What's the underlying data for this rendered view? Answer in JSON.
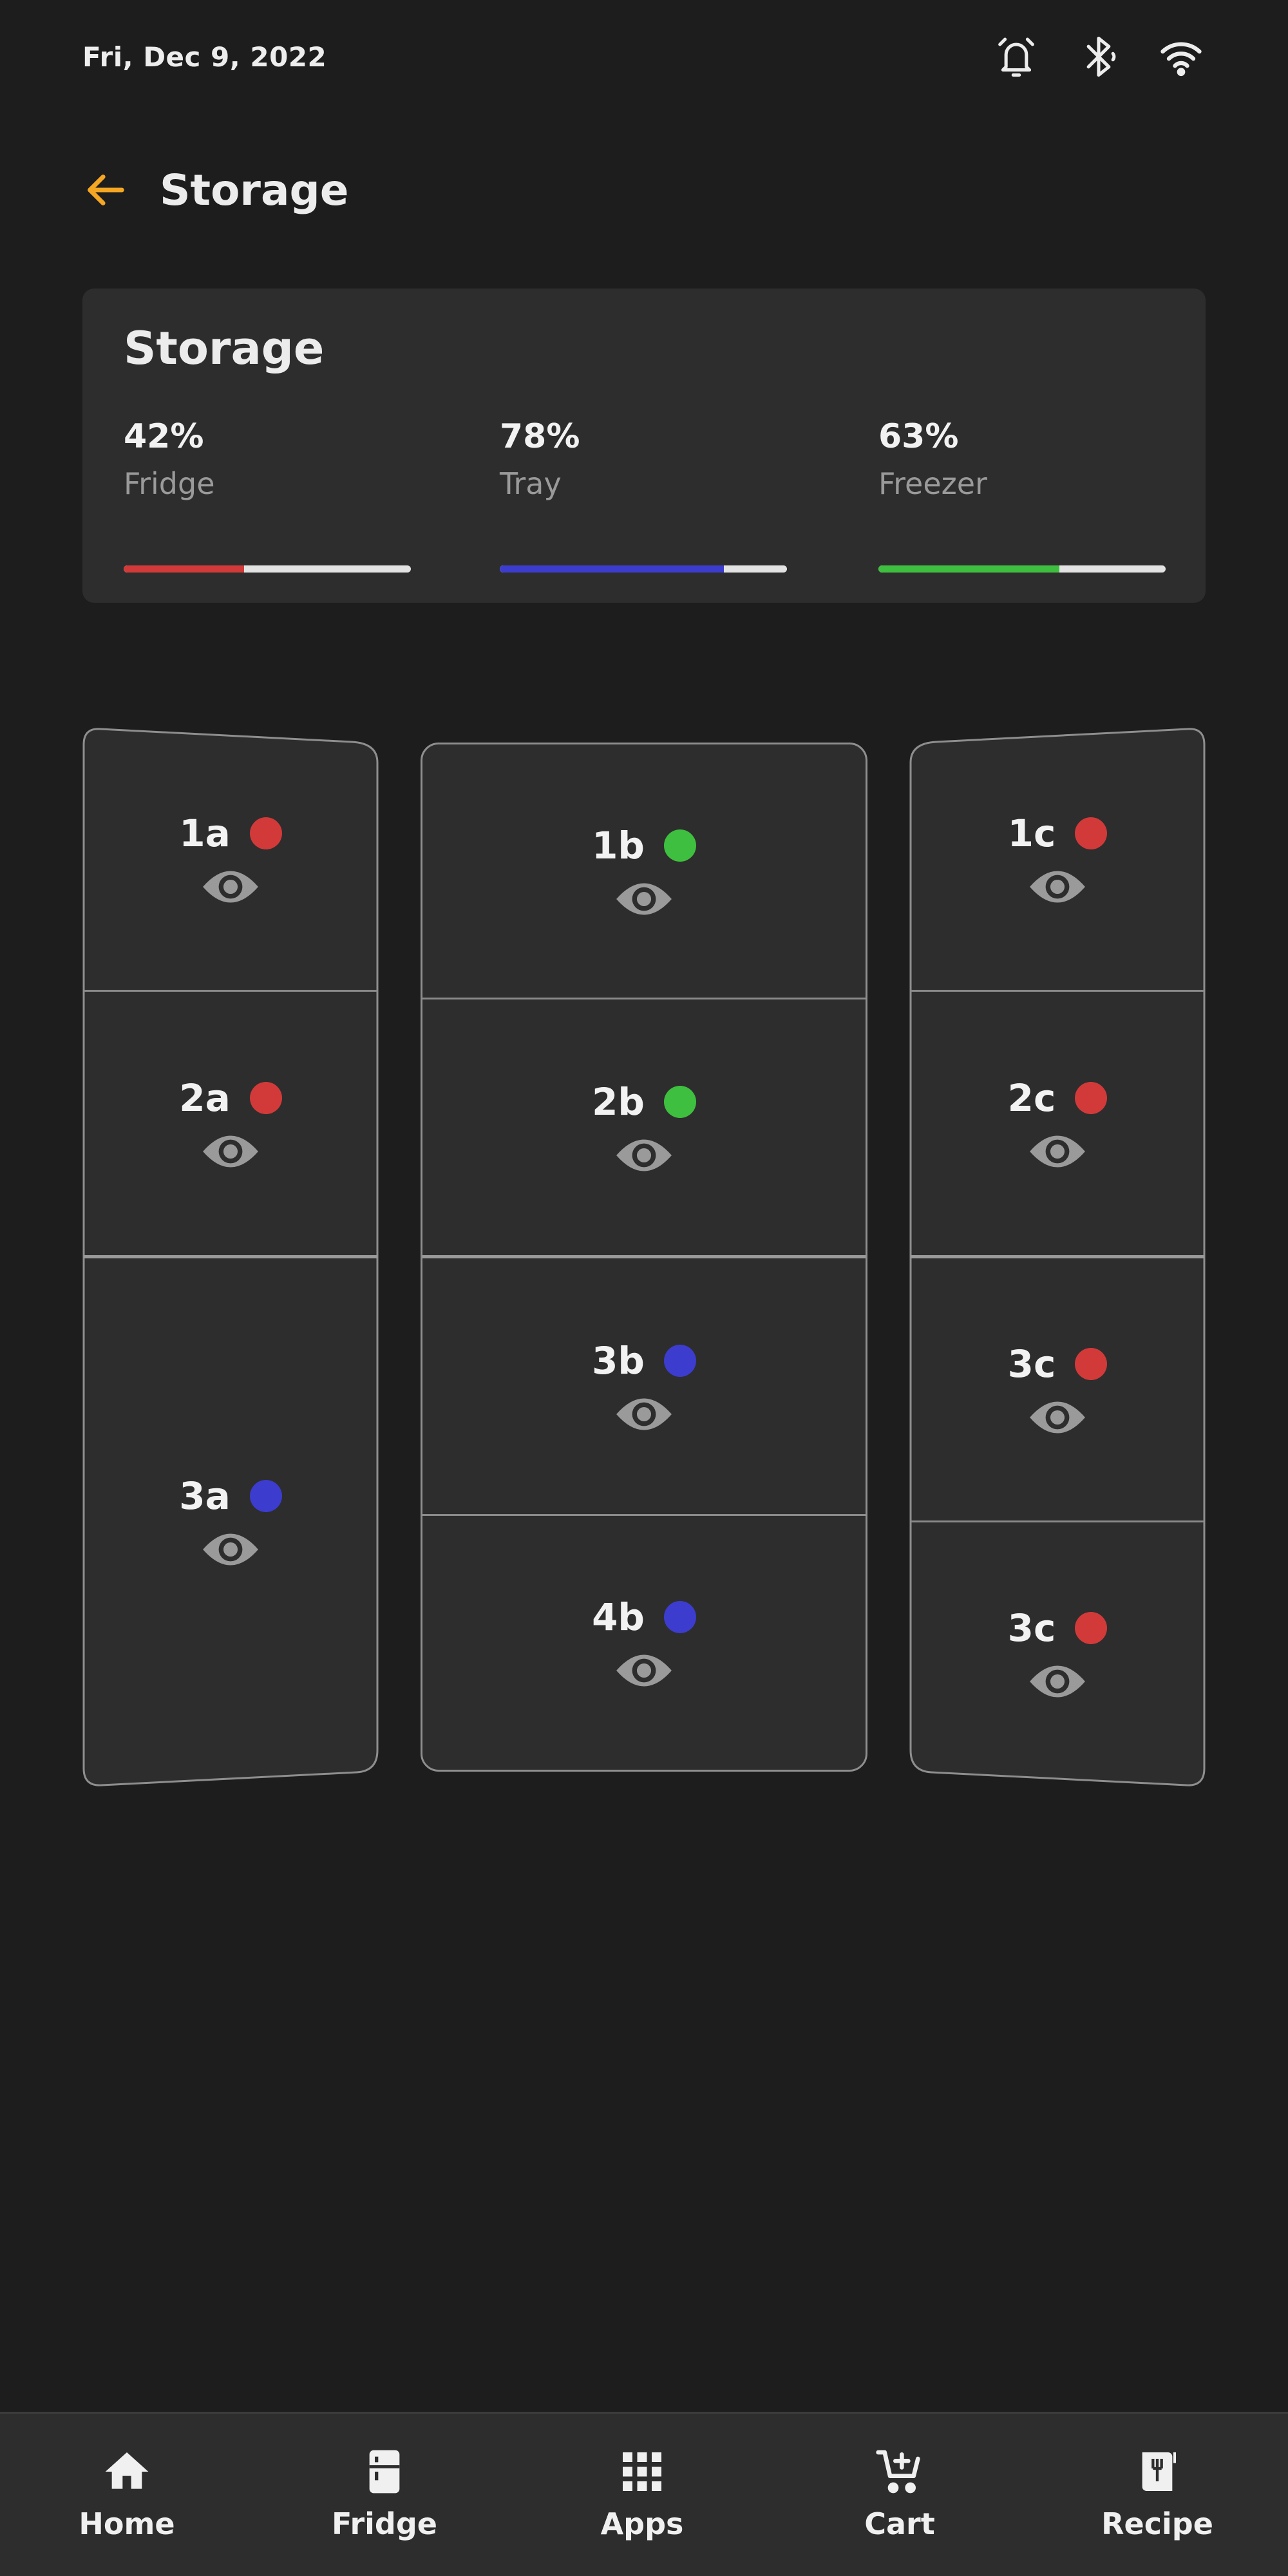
{
  "status": {
    "date": "Fri, Dec 9, 2022",
    "icons": [
      "alarm-icon",
      "bluetooth-icon",
      "wifi-icon"
    ]
  },
  "header": {
    "title": "Storage",
    "back_icon": "arrow-back-icon",
    "accent": "#f5a623"
  },
  "summary": {
    "title": "Storage",
    "stats": [
      {
        "percent": "42%",
        "label": "Fridge",
        "fill": 0.42,
        "color": "#d23a3a"
      },
      {
        "percent": "78%",
        "label": "Tray",
        "fill": 0.78,
        "color": "#3c3ccf"
      },
      {
        "percent": "63%",
        "label": "Freezer",
        "fill": 0.63,
        "color": "#3fbf3f"
      }
    ]
  },
  "status_colors": {
    "red": "#d23a3a",
    "green": "#3fbf3f",
    "blue": "#3c3ccf"
  },
  "compartments": {
    "left": [
      {
        "label": "1a",
        "status": "red"
      },
      {
        "label": "2a",
        "status": "red"
      },
      {
        "label": "3a",
        "status": "blue"
      }
    ],
    "center": [
      {
        "label": "1b",
        "status": "green"
      },
      {
        "label": "2b",
        "status": "green"
      },
      {
        "label": "3b",
        "status": "blue"
      },
      {
        "label": "4b",
        "status": "blue"
      }
    ],
    "right": [
      {
        "label": "1c",
        "status": "red"
      },
      {
        "label": "2c",
        "status": "red"
      },
      {
        "label": "3c",
        "status": "red"
      },
      {
        "label": "3c",
        "status": "red"
      }
    ]
  },
  "nav": [
    {
      "label": "Home",
      "icon": "home-icon"
    },
    {
      "label": "Fridge",
      "icon": "fridge-icon"
    },
    {
      "label": "Apps",
      "icon": "apps-grid-icon"
    },
    {
      "label": "Cart",
      "icon": "cart-add-icon"
    },
    {
      "label": "Recipe",
      "icon": "recipe-icon"
    }
  ]
}
